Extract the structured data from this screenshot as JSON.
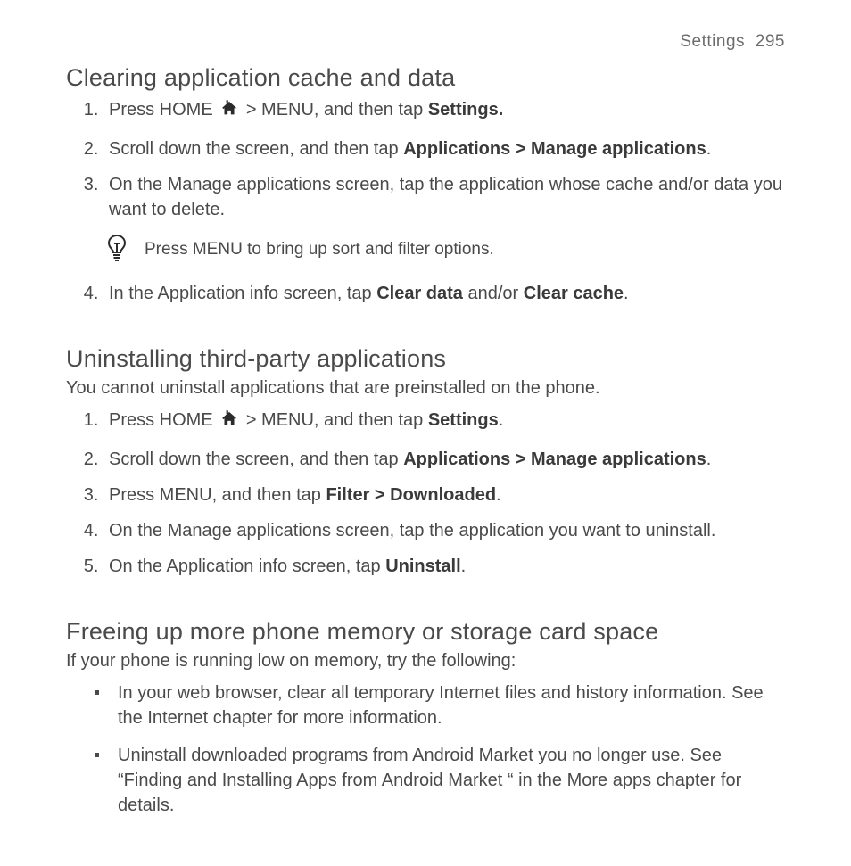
{
  "header": {
    "section_label": "Settings",
    "page_number": "295"
  },
  "sections": [
    {
      "title": "Clearing application cache and data",
      "lead": "",
      "steps": [
        {
          "pre": "Press HOME ",
          "home_icon": true,
          "mid": " > MENU, and then tap ",
          "bold1": "Settings.",
          "post": ""
        },
        {
          "pre": "Scroll down the screen, and then tap ",
          "bold1": "Applications > Manage applications",
          "post": "."
        },
        {
          "pre": "On the Manage applications screen, tap the application whose cache and/or data you want to delete.",
          "post": ""
        },
        {
          "is_tip": true,
          "tip": "Press MENU to bring up sort and filter options."
        },
        {
          "pre": "In the Application info screen, tap ",
          "bold1": "Clear data",
          "mid": " and/or ",
          "bold2": "Clear cache",
          "post": "."
        }
      ]
    },
    {
      "title": "Uninstalling third-party applications",
      "lead": "You cannot uninstall applications that are preinstalled on the phone.",
      "steps": [
        {
          "pre": "Press HOME ",
          "home_icon": true,
          "mid": " > MENU, and then tap ",
          "bold1": "Settings",
          "post": "."
        },
        {
          "pre": "Scroll down the screen, and then tap ",
          "bold1": "Applications > Manage applications",
          "post": "."
        },
        {
          "pre": "Press MENU, and then tap ",
          "bold1": "Filter > Downloaded",
          "post": "."
        },
        {
          "pre": "On the Manage applications screen, tap the application you want to uninstall.",
          "post": ""
        },
        {
          "pre": "On the Application info screen, tap ",
          "bold1": "Uninstall",
          "post": "."
        }
      ]
    },
    {
      "title": "Freeing up more phone memory or storage card space",
      "lead": "If your phone is running low on memory, try the following:",
      "bullets": [
        "In your web browser, clear all temporary Internet files and history information. See the Internet chapter for more information.",
        "Uninstall downloaded programs from Android Market you no longer use. See “Finding and Installing Apps from Android Market “ in the More apps chapter for details."
      ]
    }
  ],
  "icons": {
    "home": "home-icon",
    "tip": "lightbulb-icon"
  }
}
